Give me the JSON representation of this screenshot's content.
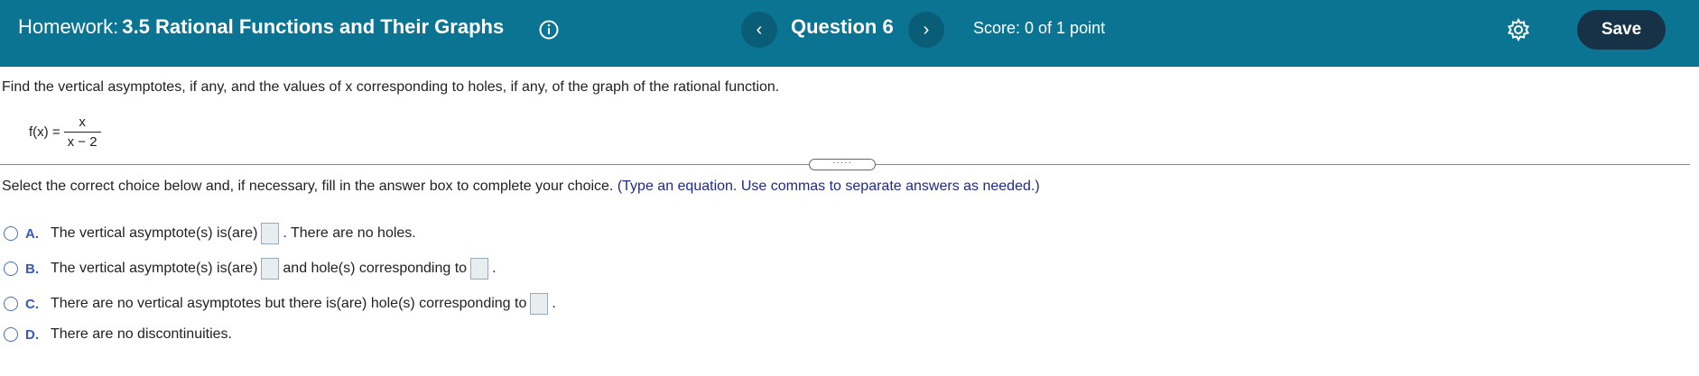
{
  "header": {
    "title_prefix": "Homework:",
    "title_name": "3.5 Rational Functions and Their Graphs",
    "question_label": "Question 6",
    "score": "Score: 0 of 1 point",
    "save_label": "Save",
    "prev_symbol": "‹",
    "next_symbol": "›"
  },
  "question": {
    "instruction": "Find the vertical asymptotes, if any, and the values of x corresponding to holes, if any, of the graph of the rational function.",
    "function_lhs": "f(x) =",
    "numerator": "x",
    "denominator": "x − 2",
    "divider_handle": "·····",
    "select_text": "Select the correct choice below and, if necessary, fill in the answer box to complete your choice.",
    "select_hint": "(Type an equation. Use commas to separate answers as needed.)"
  },
  "choices": [
    {
      "letter": "A.",
      "text_before": "The vertical asymptote(s) is(are)",
      "text_after": ". There are no holes."
    },
    {
      "letter": "B.",
      "text_before": "The vertical asymptote(s) is(are)",
      "text_middle": "and hole(s) corresponding to",
      "text_after": "."
    },
    {
      "letter": "C.",
      "text_before": "There are no vertical asymptotes but there is(are) hole(s) corresponding to",
      "text_after": "."
    },
    {
      "letter": "D.",
      "text_before": "There are no discontinuities."
    }
  ],
  "colors": {
    "header_bg": "#0b7493",
    "save_bg": "#173247",
    "choice_letter": "#3b57b8",
    "hint_text": "#1f2a8a"
  },
  "icons": [
    "info-icon",
    "gear-icon",
    "chevron-left-icon",
    "chevron-right-icon"
  ]
}
